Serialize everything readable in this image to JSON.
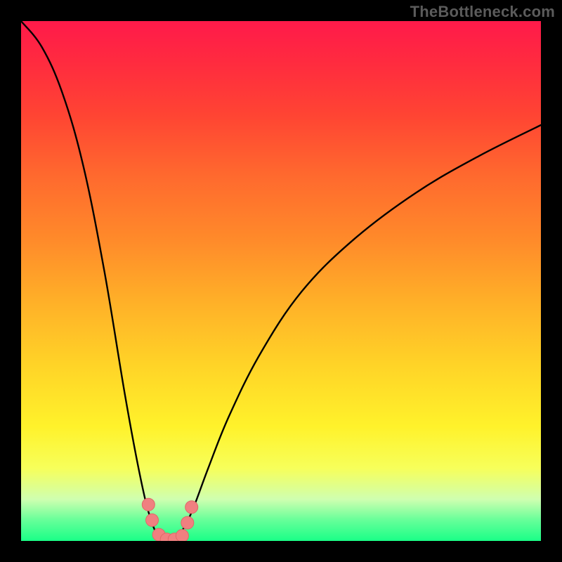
{
  "watermark": "TheBottleneck.com",
  "colors": {
    "frame": "#000000",
    "gradient_top": "#ff1a4a",
    "gradient_bottom": "#1aff87",
    "curve": "#000000",
    "marker_fill": "#f08080",
    "marker_stroke": "#e06868"
  },
  "chart_data": {
    "type": "line",
    "title": "",
    "xlabel": "",
    "ylabel": "",
    "xlim": [
      0,
      100
    ],
    "ylim": [
      0,
      100
    ],
    "grid": false,
    "legend": false,
    "annotations": [],
    "description": "V-shaped bottleneck deviation curve over a vertical red→green gradient. Valley floor sits near zero around x≈26–32; left branch rises steeply to the top edge, right branch rises gradually to ~80% by the right edge. Salmon markers cluster at the valley.",
    "series": [
      {
        "name": "curve",
        "x": [
          0,
          4,
          8,
          12,
          16,
          20,
          23,
          25,
          27,
          29,
          31,
          33,
          36,
          40,
          46,
          54,
          64,
          76,
          88,
          100
        ],
        "y": [
          100,
          95,
          86,
          72,
          52,
          28,
          12,
          4,
          0,
          0,
          2,
          6,
          14,
          24,
          36,
          48,
          58,
          67,
          74,
          80
        ]
      }
    ],
    "markers": [
      {
        "x": 24.5,
        "y": 7
      },
      {
        "x": 25.2,
        "y": 4
      },
      {
        "x": 26.5,
        "y": 1.2
      },
      {
        "x": 28.0,
        "y": 0.3
      },
      {
        "x": 29.5,
        "y": 0.3
      },
      {
        "x": 31.0,
        "y": 1.0
      },
      {
        "x": 32.0,
        "y": 3.5
      },
      {
        "x": 32.8,
        "y": 6.5
      }
    ]
  }
}
